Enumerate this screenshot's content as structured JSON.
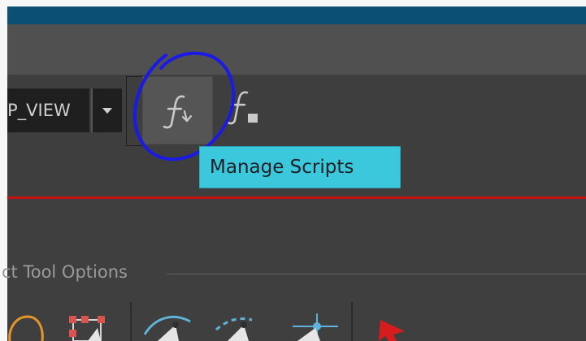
{
  "toolbar": {
    "view_dropdown": {
      "value": "P_VIEW"
    }
  },
  "tooltip": {
    "text": "Manage Scripts"
  },
  "tool_options": {
    "title": "ct Tool Options"
  },
  "colors": {
    "title_bar": "#0c4f74",
    "tooltip_bg": "#3cc8dc",
    "annotation": "#1a1ae6",
    "red_line": "#c41010"
  },
  "icons": [
    "manage-scripts-icon",
    "run-script-icon",
    "chevron-down-icon",
    "lasso-icon",
    "transform-icon",
    "select-tool-icon",
    "pen-tool-icon",
    "pivot-tool-icon",
    "cursor-icon"
  ]
}
